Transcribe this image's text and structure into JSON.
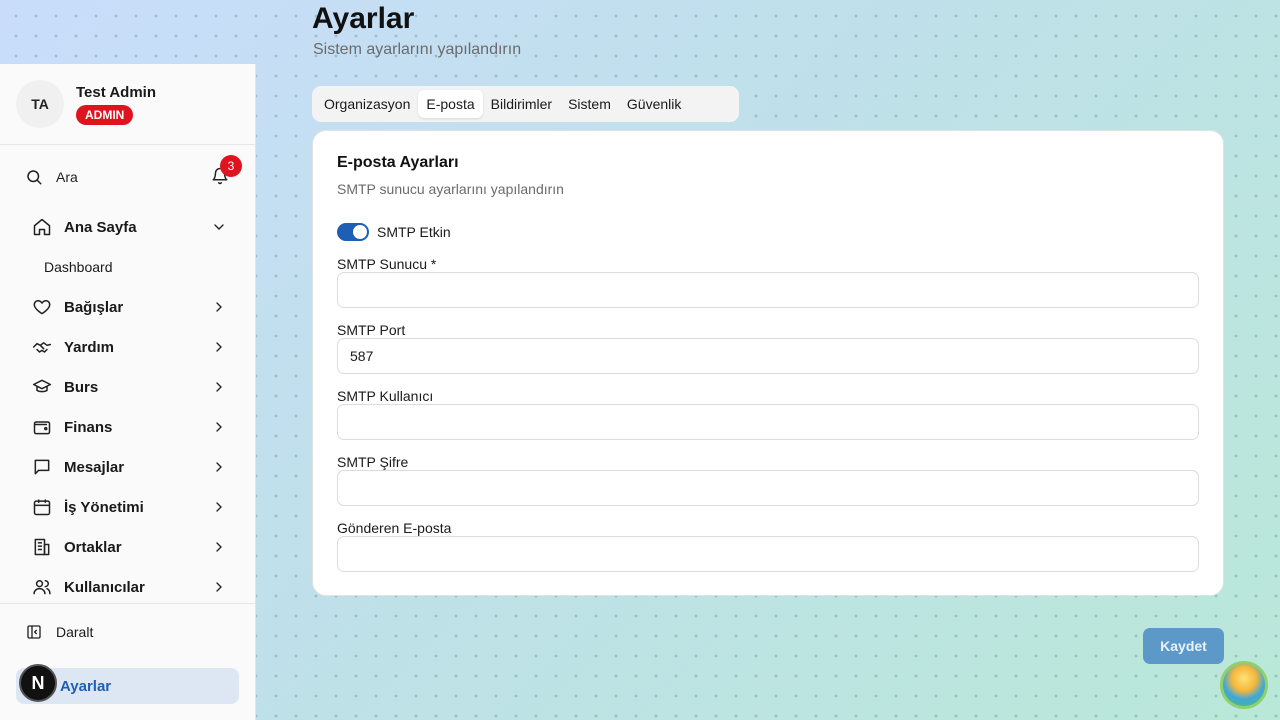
{
  "user": {
    "initials": "TA",
    "name": "Test Admin",
    "role": "ADMIN"
  },
  "search": {
    "label": "Ara"
  },
  "notifications": {
    "count": "3"
  },
  "nav": {
    "items": [
      {
        "label": "Ana Sayfa",
        "icon": "home-icon",
        "expanded": true
      },
      {
        "label": "Dashboard",
        "sub": true
      },
      {
        "label": "Bağışlar",
        "icon": "heart-icon"
      },
      {
        "label": "Yardım",
        "icon": "handshake-icon"
      },
      {
        "label": "Burs",
        "icon": "graduation-cap-icon"
      },
      {
        "label": "Finans",
        "icon": "wallet-icon"
      },
      {
        "label": "Mesajlar",
        "icon": "message-icon"
      },
      {
        "label": "İş Yönetimi",
        "icon": "calendar-icon"
      },
      {
        "label": "Ortaklar",
        "icon": "building-icon"
      },
      {
        "label": "Kullanıcılar",
        "icon": "users-icon"
      }
    ]
  },
  "footer": {
    "collapse_label": "Daralt",
    "settings_label": "Ayarlar",
    "n_badge": "N"
  },
  "header": {
    "title": "Ayarlar",
    "subtitle": "Sistem ayarlarını yapılandırın"
  },
  "tabs": [
    {
      "label": "Organizasyon",
      "active": false
    },
    {
      "label": "E-posta",
      "active": true
    },
    {
      "label": "Bildirimler",
      "active": false
    },
    {
      "label": "Sistem",
      "active": false
    },
    {
      "label": "Güvenlik",
      "active": false
    }
  ],
  "card": {
    "title": "E-posta Ayarları",
    "description": "SMTP sunucu ayarlarını yapılandırın",
    "smtp_toggle": {
      "label": "SMTP Etkin",
      "on": true
    },
    "fields": [
      {
        "label": "SMTP Sunucu *",
        "value": ""
      },
      {
        "label": "SMTP Port",
        "value": "587"
      },
      {
        "label": "SMTP Kullanıcı",
        "value": ""
      },
      {
        "label": "SMTP Şifre",
        "value": ""
      },
      {
        "label": "Gönderen E-posta",
        "value": ""
      }
    ]
  },
  "actions": {
    "save_label": "Kaydet"
  },
  "colors": {
    "accent": "#1d5fb4",
    "badge_red": "#e0141e",
    "save_button": "#5d99c8"
  }
}
